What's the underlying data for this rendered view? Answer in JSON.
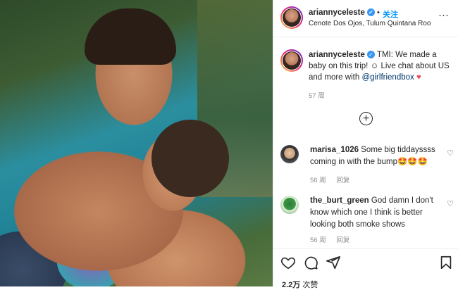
{
  "post": {
    "username": "ariannyceleste",
    "verified_glyph": "✓",
    "follow_separator": "•",
    "follow_label": "关注",
    "location": "Cenote Dos Ojos, Tulum Quintana Roo",
    "more_icon": "more-horizontal-icon",
    "more_glyph": "···"
  },
  "caption": {
    "username": "ariannyceleste",
    "text": "TMI: We made a baby on this trip! ☺ Live chat about US and more with ",
    "mention": "@girlfriendbox",
    "emoji": "♥",
    "time": "57 周"
  },
  "load_more": {
    "icon": "plus-circle-icon",
    "glyph": "+"
  },
  "comments": [
    {
      "username": "marisa_1026",
      "text": "Some big tiddayssss coming in with the bump🤩🤩🤩",
      "time": "56 周",
      "reply": "回复"
    },
    {
      "username": "the_burt_green",
      "text": "God damn I don't know which one I think is better looking both smoke shows",
      "time": "56 周",
      "reply": "回复"
    }
  ],
  "actions": {
    "like_icon": "heart-icon",
    "comment_icon": "comment-icon",
    "share_icon": "send-icon",
    "save_icon": "bookmark-icon"
  },
  "views": {
    "count": "2.2万",
    "suffix": "次赞"
  },
  "colors": {
    "accent": "#0095f6",
    "verified": "#3897f0",
    "text": "#262626",
    "muted": "#8e8e8e",
    "heart": "#ed4956",
    "mention": "#00376b"
  }
}
